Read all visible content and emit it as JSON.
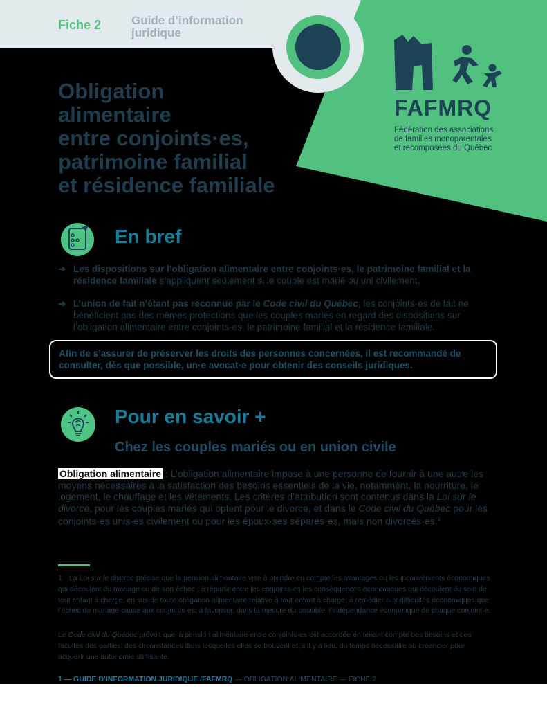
{
  "header": {
    "fiche": "Fiche 2",
    "guide_line1": "Guide d’information",
    "guide_line2": "juridique"
  },
  "title_lines": [
    "Obligation",
    "alimentaire",
    "entre conjoints·es,",
    "patrimoine familial",
    "et résidence familiale"
  ],
  "logo": {
    "name": "FAFMRQ",
    "subtitle_lines": [
      "Fédération des associations",
      "de familles monoparentales",
      "et recomposées du Québec"
    ]
  },
  "en_bref": {
    "heading": "En bref",
    "icon": "checklist-icon",
    "bullet1_bold": "Les dispositions sur l’obligation alimentaire entre conjoints·es, le patrimoine familial et la résidence familiale",
    "bullet1_rest": " s’appliquent seulement si le couple est marié ou uni civilement.",
    "bullet2_bold": "L’union de fait n’étant pas reconnue par le ",
    "bullet2_italic": "Code civil du Québec",
    "bullet2_rest": ", les conjoints·es de fait ne bénéficient pas des mêmes protections que les couples mariés en regard des dispositions sur l’obligation alimentaire entre conjoints·es, le patrimoine familial et la résidence familiale.",
    "recommendation": "Afin de s’assurer de préserver les droits des personnes concernées, il est recommandé de consulter, dès que possible, un·e avocat·e pour obtenir des conseils juridiques."
  },
  "savoir": {
    "heading": "Pour en savoir +",
    "icon": "lightbulb-brain-icon",
    "subheading": "Chez les couples mariés ou en union civile",
    "term": "Obligation alimentaire",
    "p1": " : L’obligation alimentaire impose à une personne de fournir à une autre les moyens nécessaires à la satisfaction des besoins essentiels de la vie, notamment, la nourriture, le logement, le chauffage et les vêtements. Les critères d’attribution sont contenus dans la ",
    "p1_it1": "Loi sur le divorce",
    "p2": ", pour les couples mariés qui optent pour le divorce, et dans le ",
    "p2_it": "Code civil du Québec",
    "p3": " pour les conjoints·es unis·es civilement ou pour les époux·ses séparés·es, mais non divorcés·es.",
    "sup": "1"
  },
  "footnotes": {
    "f1_num": "1",
    "f1_pre": "La ",
    "f1_it": "Loi sur le divorce",
    "f1_rest": " précise que la pension alimentaire vise à prendre en compte les avantages ou les inconvénients économiques qui découlent du mariage ou de son échec ; à répartir entre les conjoints·es les conséquences économiques qui découlent du soin de tout enfant à charge, en sus de toute obligation alimentaire relative à tout enfant à charge; à remédier aux difficultés économiques que l’échec du mariage cause aux conjoints·es; à favoriser, dans la mesure du possible, l’indépendance économique de chaque conjoint·e.",
    "f2_pre": "Le ",
    "f2_it": "Code civil du Québec",
    "f2_rest": " prévoit que la pension alimentaire entre conjoints·es est accordée en tenant compte des besoins et des facultés des parties, des circonstances dans lesquelles elles se trouvent et, s’il y a lieu, du temps nécessaire au créancier pour acquérir une autonomie suffisante."
  },
  "footer": {
    "bold": "1 — GUIDE D’INFORMATION JURIDIQUE /FAFMRQ",
    "rest": " — OBLIGATION ALIMENTAIRE — FICHE 2"
  },
  "colors": {
    "green": "#4ec484",
    "navy": "#1e4256",
    "teal_heading": "#1c7c99"
  }
}
